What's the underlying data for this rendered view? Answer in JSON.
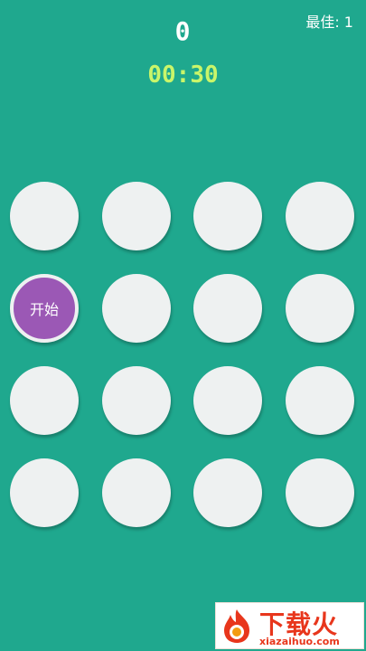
{
  "header": {
    "best_label": "最佳: 1",
    "score": "0",
    "timer": "00:30"
  },
  "board": {
    "rows": 4,
    "cols": 4,
    "start_label": "开始",
    "start_position": {
      "row": 2,
      "col": 1
    }
  },
  "watermark": {
    "title": "下载火",
    "url": "xiazaihuo.com"
  },
  "colors": {
    "background": "#1fa88e",
    "cell": "#eef1f1",
    "start_button": "#9b58b5",
    "timer": "#c9f56a",
    "watermark": "#e8361c"
  }
}
